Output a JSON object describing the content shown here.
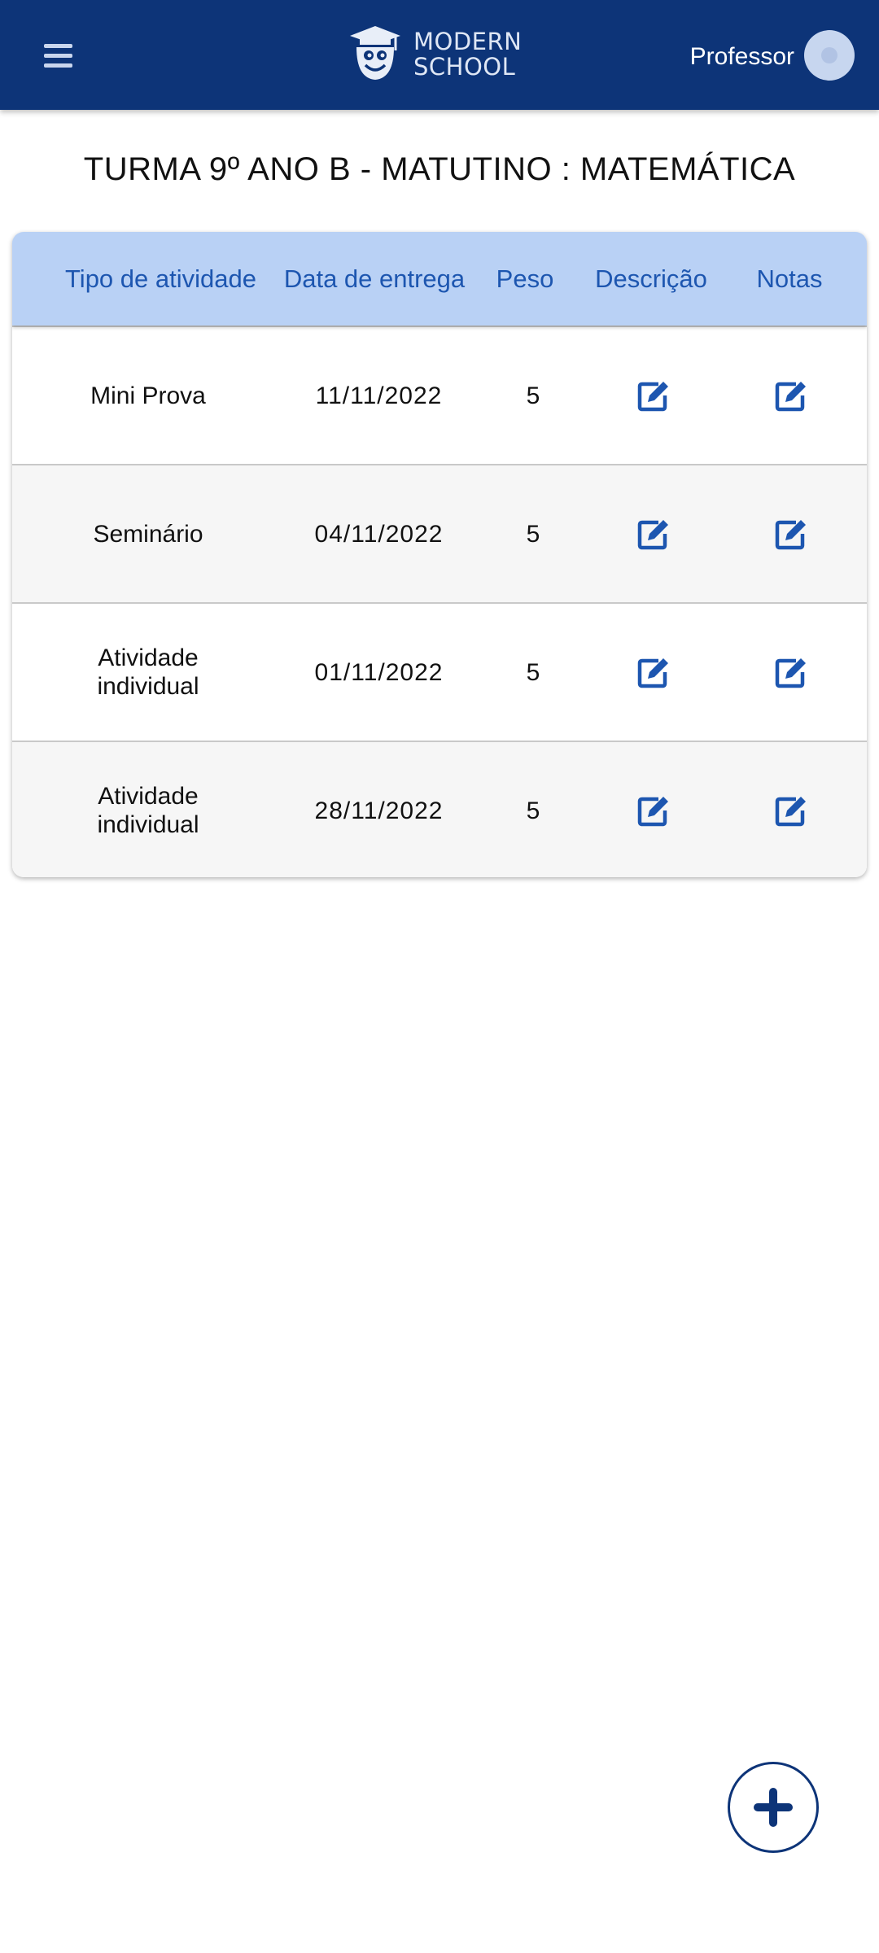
{
  "header": {
    "menu_icon": "hamburger-menu-icon",
    "logo": {
      "line1": "MODERN",
      "line2": "SCHOOL",
      "icon": "graduation-cap-mascot-icon"
    },
    "user_label": "Professor",
    "avatar_icon": "user-avatar-icon"
  },
  "page": {
    "title": "TURMA 9º ANO B - MATUTINO : MATEMÁTICA"
  },
  "table": {
    "columns": [
      "Tipo de atividade",
      "Data de entrega",
      "Peso",
      "Descrição",
      "Notas"
    ],
    "rows": [
      {
        "tipo": "Mini Prova",
        "data": "11/11/2022",
        "peso": "5"
      },
      {
        "tipo": "Seminário",
        "data": "04/11/2022",
        "peso": "5"
      },
      {
        "tipo": "Atividade individual",
        "data": "01/11/2022",
        "peso": "5"
      },
      {
        "tipo": "Atividade individual",
        "data": "28/11/2022",
        "peso": "5"
      }
    ],
    "row_action_icon": "edit-icon"
  },
  "fab": {
    "icon": "plus-icon"
  },
  "colors": {
    "primary": "#0d3478",
    "header_row": "#b9d1f5",
    "accent_blue": "#1d56b0",
    "row_alt": "#f6f6f6"
  }
}
